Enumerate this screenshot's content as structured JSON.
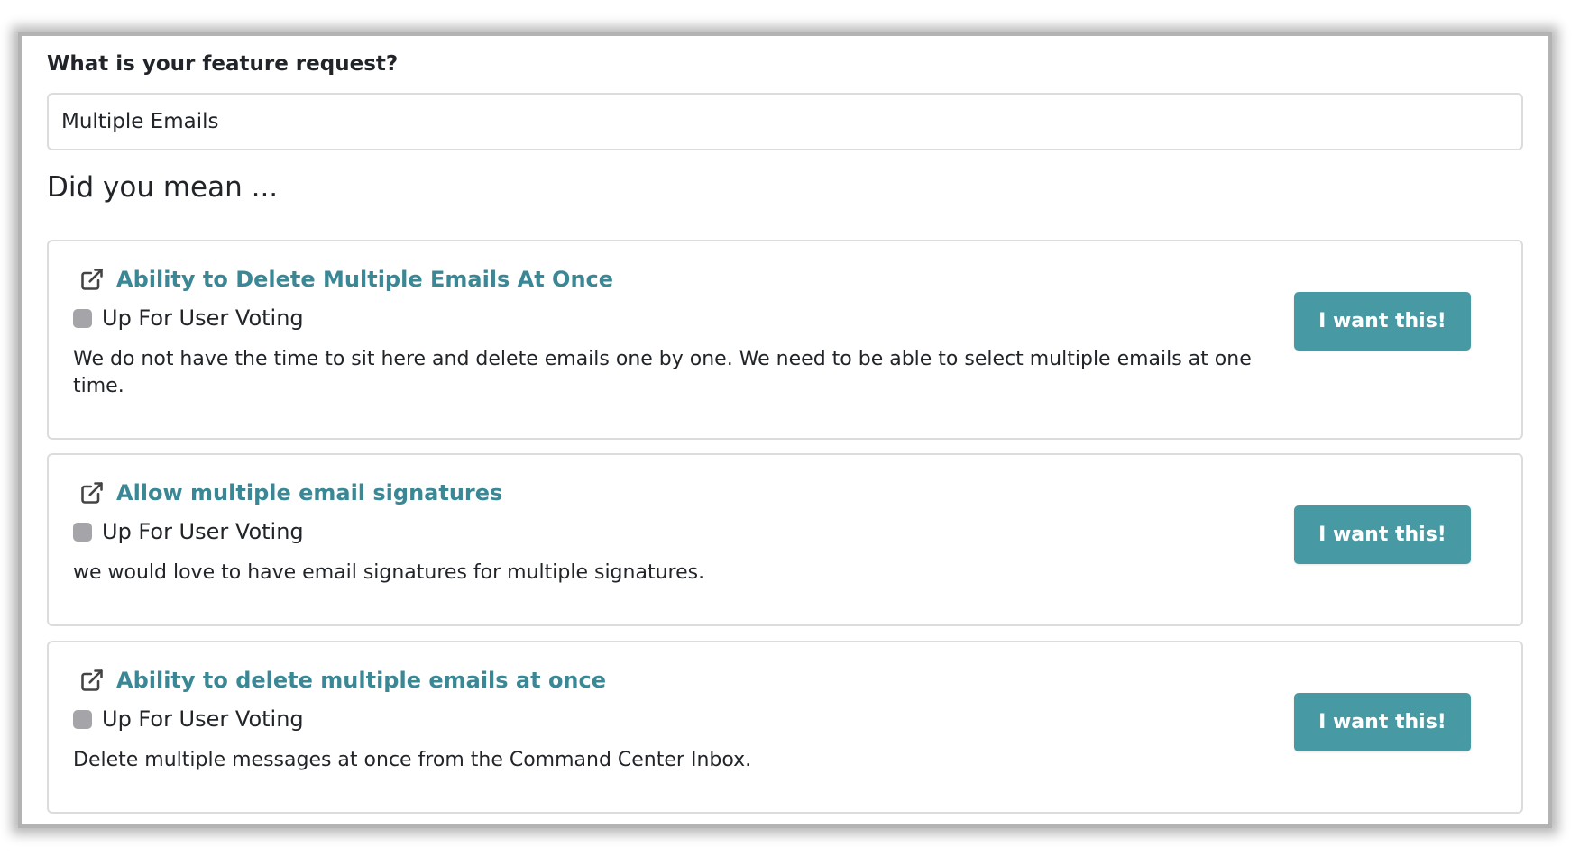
{
  "form": {
    "question_label": "What is your feature request?",
    "input_value": "Multiple Emails"
  },
  "suggestions_heading": "Did you mean ...",
  "suggestions": [
    {
      "title": "Ability to Delete Multiple Emails At Once",
      "status": "Up For User Voting",
      "description": "We do not have the time to sit here and delete emails one by one. We need to be able to select multiple emails at one time.",
      "button_label": "I want this!"
    },
    {
      "title": "Allow multiple email signatures",
      "status": "Up For User Voting",
      "description": "we would love to have email signatures for multiple signatures.",
      "button_label": "I want this!"
    },
    {
      "title": "Ability to delete multiple emails at once",
      "status": "Up For User Voting",
      "description": "Delete multiple messages at once from the Command Center Inbox.",
      "button_label": "I want this!"
    }
  ],
  "icons": {
    "title_link": "external-link-icon",
    "status": "status-dot-icon"
  },
  "colors": {
    "link": "#3a8896",
    "button_bg": "#4799a3",
    "button_text": "#ffffff",
    "status_dot": "#a4a4a9",
    "border": "#dcdcdc"
  }
}
